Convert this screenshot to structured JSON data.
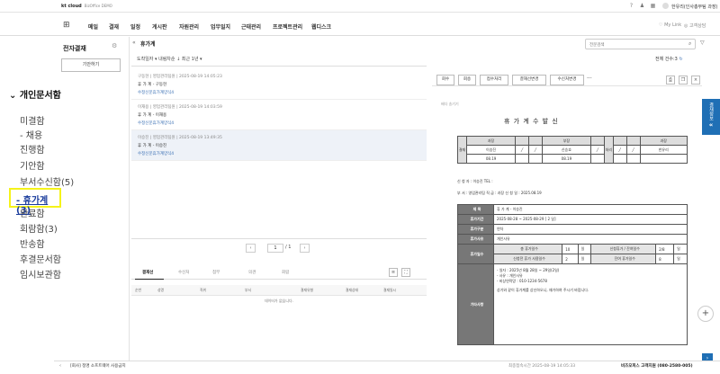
{
  "topbar": {
    "logo": "kt cloud",
    "logo_sub": "BizOffice DEMO",
    "user": "한유리(인사총무팀 과장)"
  },
  "nav": {
    "menus": [
      "메일",
      "결재",
      "일정",
      "게시판",
      "자원관리",
      "업무일지",
      "근태관리",
      "프로젝트관리",
      "웹디스크"
    ],
    "mylink": "My Link",
    "customer": "고객상담"
  },
  "sidebar": {
    "title": "전자결재",
    "draft_button": "기안하기"
  },
  "tree": {
    "head": "개인문서함",
    "items": [
      "미결함",
      "- 채용",
      "진행함",
      "기안함",
      "부서수신함(5)",
      "완료함",
      "회람함(3)",
      "반송함",
      "후결문서함",
      "임시보관함"
    ],
    "active": "- 휴가계(3)"
  },
  "list": {
    "folder": "휴가계",
    "filters": "도착일자 ▾   내림차순 ↓   최근 1년 ▾",
    "items": [
      {
        "meta": "구동현 | 영업관리팀원 | 2025-08-19 14:05:23",
        "title": "휴 가 계 - 구동현",
        "form": "수정신문휴가계양식4"
      },
      {
        "meta": "이재용 | 영업관리팀원 | 2025-08-19 14:03:59",
        "title": "휴 가 계 - 이재용",
        "form": "수정신문휴가계양식4"
      },
      {
        "meta": "이승진 | 영업관리팀원 | 2025-08-19 13:49:35",
        "title": "휴 가 계 - 이승진",
        "form": "수정신문휴가계양식4"
      }
    ],
    "page": "1",
    "pages": "/ 1"
  },
  "lower": {
    "tabs": [
      "결재선",
      "수신처",
      "첨부",
      "의견",
      "회람"
    ],
    "cols": [
      "순번",
      "성명",
      "직위",
      "부서",
      "결재유형",
      "결재상태",
      "결재일시"
    ],
    "empty": "데이터가 없습니다."
  },
  "right": {
    "search_placeholder": "전문검색",
    "total": "전체 건수:3",
    "toolbar": [
      "회수",
      "회송",
      "접수처리",
      "결재선변경",
      "수신처변경"
    ],
    "more": "···",
    "sender": "배다 송기기",
    "doc_title": "휴 가 계 수 발 신",
    "approval": {
      "gyeol": "결재",
      "cheo": "처리",
      "roles": [
        "과장",
        "부장",
        "과장"
      ],
      "names": [
        "이승진",
        "신승호",
        "한유리"
      ],
      "dates": [
        "08.19",
        "08.19"
      ]
    },
    "meta1": "신  청  자 : 이승진              TEL :",
    "meta2": "부     서 : 영업관리팀       직     급 : 과장              신  청  일 :        2025.08.19",
    "detail": {
      "subject_h": "제    목",
      "subject": "휴 가 계 - 이승진",
      "period_h": "휴가기간",
      "period": "2025-08-28       ~       2025-08-29     [    2    일]",
      "type_h": "휴가구분",
      "type": "연차",
      "reason_h": "휴가사유",
      "reason": "개인사유",
      "days_h": "휴가일수",
      "days_r1": [
        "총 휴가일수",
        "10",
        "일",
        "신청휴가 / 잔여일수",
        "2/8",
        "일"
      ],
      "days_r2": [
        "신청전 휴가 사용일수",
        "2",
        "일",
        "잔여 휴가일수",
        "8",
        "일"
      ],
      "etc_h": "기타사항",
      "etc1": "- 일자 : 2025년 8월 28일 ~ 29일(2일)",
      "etc2": "- 사유 : 개인사유",
      "etc3": "- 비상연락망 : 010-1234-5678",
      "etc4": "상기와 같이 휴가계를 상신하오니, 재가하여 주시기 바랍니다."
    }
  },
  "rail": {
    "label": "결재정보",
    "arrow": "«"
  },
  "bottom": {
    "arrow": "‹",
    "notice": "[회사] 정명 소프트웨어 사용금지",
    "time": "최종접속시간 2025-08-19 14:05:33",
    "help": "비즈오피스 고객지원 (080-2580-005)"
  }
}
